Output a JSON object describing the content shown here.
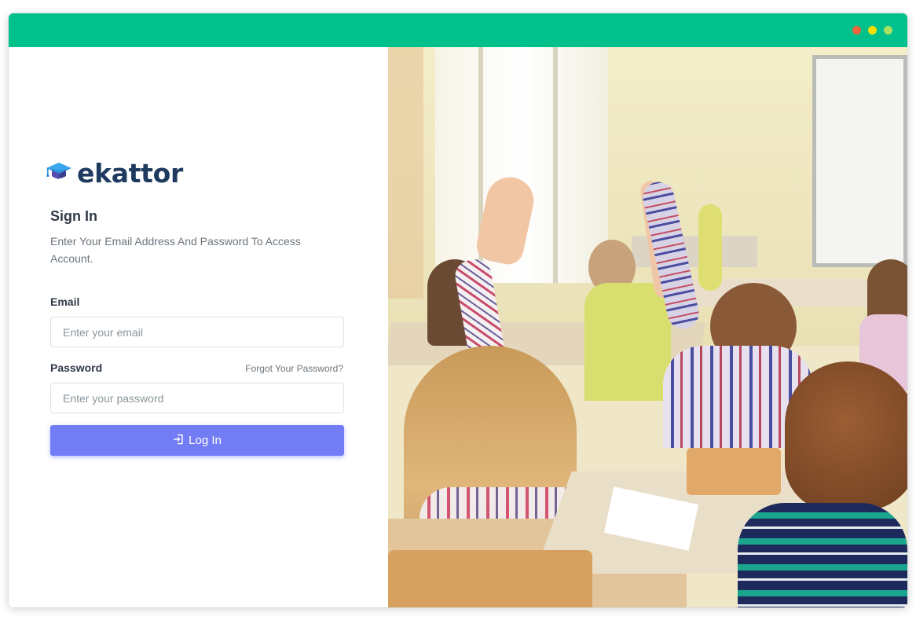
{
  "window": {
    "titlebar_color": "#00c08b",
    "controls": [
      {
        "name": "close",
        "color": "#f0643c"
      },
      {
        "name": "minimize",
        "color": "#f7e000"
      },
      {
        "name": "maximize",
        "color": "#a8e063"
      }
    ]
  },
  "brand": {
    "name": "ekattor",
    "icon": "graduation-cap-icon"
  },
  "form": {
    "title": "Sign In",
    "subtitle": "Enter Your Email Address And Password To Access Account.",
    "email_label": "Email",
    "email_placeholder": "Enter your email",
    "email_value": "",
    "password_label": "Password",
    "password_placeholder": "Enter your password",
    "password_value": "",
    "forgot_label": "Forgot Your Password?",
    "login_label": "Log In",
    "login_icon": "login-icon",
    "accent_color": "#727cf5"
  },
  "hero": {
    "description_icon": "classroom-photo"
  }
}
